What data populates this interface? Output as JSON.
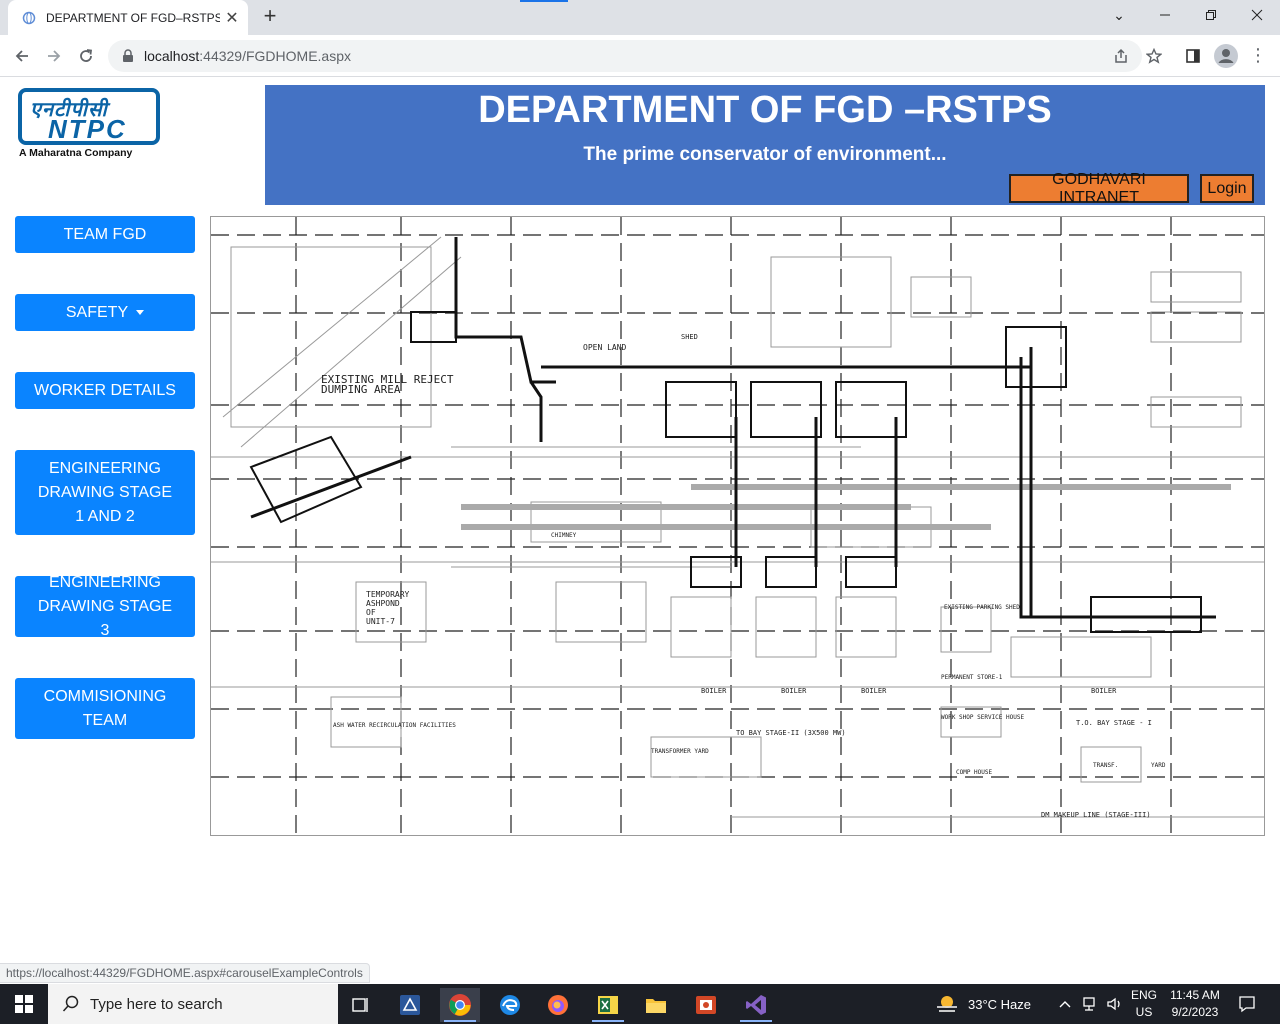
{
  "browser": {
    "tab_title": "DEPARTMENT OF FGD–RSTPS",
    "url_host": "localhost",
    "url_path": ":44329/FGDHOME.aspx",
    "status_url": "https://localhost:44329/FGDHOME.aspx#carouselExampleControls"
  },
  "logo": {
    "hindi": "एनटीपीसी",
    "brand": "NTPC",
    "tagline": "A Maharatna Company"
  },
  "header": {
    "title": "DEPARTMENT OF FGD –RSTPS",
    "subtitle": "The prime conservator of environment...",
    "intranet_label": "GODHAVARI INTRANET",
    "login_label": "Login"
  },
  "sidebar": {
    "items": [
      {
        "label": "TEAM FGD"
      },
      {
        "label": "SAFETY"
      },
      {
        "label": "WORKER DETAILS"
      },
      {
        "label": "ENGINEERING DRAWING STAGE 1 AND 2"
      },
      {
        "label": "ENGINEERING DRAWING STAGE 3"
      },
      {
        "label": "COMMISIONING TEAM"
      }
    ]
  },
  "drawing": {
    "labels": {
      "mill_reject_1": "EXISTING MILL REJECT",
      "mill_reject_2": "DUMPING AREA",
      "open_land": "OPEN LAND",
      "temp_ashpond_1": "TEMPORARY",
      "temp_ashpond_2": "ASHPOND",
      "temp_ashpond_3": "OF",
      "temp_ashpond_4": "UNIT-7",
      "boiler": "BOILER",
      "bay_stage_2": "TO BAY STAGE-II (3X500 MW)",
      "bay_stage_1": "T.O. BAY STAGE - I",
      "dm_makeup": "DM MAKEUP LINE (STAGE-III)",
      "transformer": "TRANSFORMER YARD",
      "workshop": "WORK SHOP SERVICE HOUSE",
      "comp_house": "COMP HOUSE",
      "existing_parking": "EXISTING PARKING SHED",
      "ash_water": "ASH WATER RECIRCULATION FACILITIES",
      "permanent_store": "PERMANENT STORE-1",
      "transf": "TRANSF.",
      "yard": "YARD",
      "chimney": "CHIMNEY",
      "shed": "SHED"
    }
  },
  "taskbar": {
    "search_placeholder": "Type here to search",
    "weather": "33°C  Haze",
    "lang_1": "ENG",
    "lang_2": "US",
    "time": "11:45 AM",
    "date": "9/2/2023"
  },
  "colors": {
    "header_bg": "#4472c4",
    "sidebar_btn": "#0a84ff",
    "header_btn": "#ed7d31"
  }
}
